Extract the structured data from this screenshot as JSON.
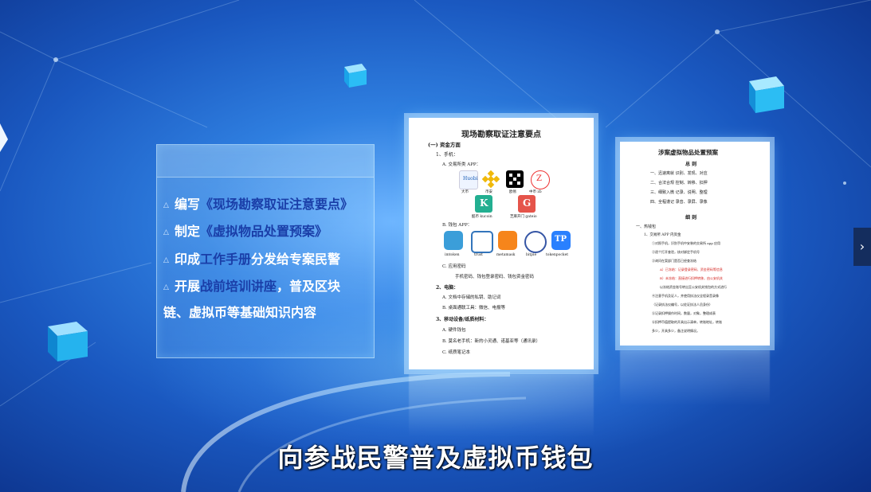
{
  "panel": {
    "bullets": [
      {
        "pre": "编写",
        "em": "《现场勘察取证注意要点》",
        "post": ""
      },
      {
        "pre": "制定",
        "em": "《虚拟物品处置预案》",
        "post": ""
      },
      {
        "pre": "印成",
        "em": "工作手册",
        "post": "分发给专案民警"
      },
      {
        "pre": "开展",
        "em": "战前培训讲座",
        "post": "，普及区块"
      },
      {
        "pre": "",
        "em": "",
        "post": "链、虚拟币等基础知识内容"
      }
    ]
  },
  "doc1": {
    "title": "现场勘察取证注意要点",
    "s1": "(一) 资金方面",
    "s1_1": "1、手机：",
    "a": "A. 交易所类 APP：",
    "exchanges": [
      "大币",
      "币安",
      "欧易",
      "中币 zb"
    ],
    "exchanges2": [
      "酷币 kucoin",
      "芝麻开门 gateio"
    ],
    "b": "B. 钱包 APP：",
    "wallets": [
      "imtoken",
      "trust",
      "metamask",
      "bitpie",
      "tokenpocket"
    ],
    "c": "C. 应用密码",
    "c_detail": "手机密码、钱包登录密码、钱包资金密码",
    "s2": "2、电脑：",
    "s2_a": "A. 文档中存储的私钥、助记词",
    "s2_b": "B. 桌面通联工具：微信、电报等",
    "s3": "3、移动设备/纸质材料：",
    "s3_a": "A. 硬件钱包",
    "s3_b": "B. 莫名老手机：新的小灵通、诺基亚等（通讯录）",
    "s3_c": "C. 纸质笔记本"
  },
  "doc2": {
    "title": "涉案虚拟物品处置预案",
    "h1": "总 则",
    "rules": [
      "一、迅速离就  识别、发现、对应",
      "二、合法合规  控制、转移、扣押",
      "三、细致入微  记录、说明、整理",
      "四、全程谨记  录音、录屏、录像"
    ],
    "h2": "细 则",
    "r1": "一、热钱包",
    "r1_1": "1、交易所 APP 内资金",
    "lines": [
      "①对照手机，识别手机中安装的交易所 app 应用",
      "②逐个打开查验，核对绑定手机号",
      "③询问在案部门是否已经查冻结",
      "A）已冻结：记录登录密码、资金密码等信息",
      "B）未冻结：直接进行扣押转移，由公安机关",
      "  以冻结资金账号转出至公安机关钱包的方式进行",
      "④注意手机及证人，并使用执法仪全程录音录像",
      "（记录执法仪编号，以佐证执法人员身份）",
      "⑤记录扣押操作时间，数量，对象，整理成表",
      "⑥扣押币值提取的开具出示清单，转账地址，转账",
      "多少，开具多少，备注说明情况。"
    ]
  },
  "subtitle": "向参战民警普及虚拟币钱包",
  "nav": {
    "next": "›"
  }
}
